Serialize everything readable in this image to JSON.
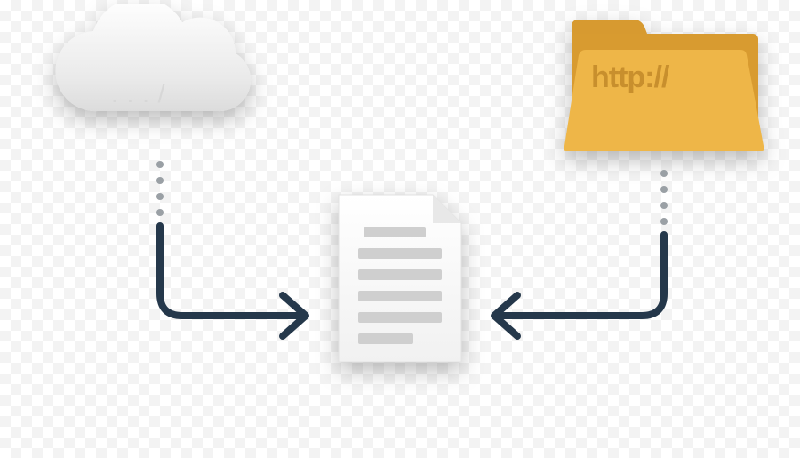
{
  "diagram": {
    "source_cloud": {
      "label": ". . . /"
    },
    "source_folder": {
      "label": "http://"
    },
    "target_document": {
      "line_count": 6
    },
    "colors": {
      "stroke": "#25384b",
      "dot": "#9aa0a5",
      "cloud_fill_light": "#f3f3f3",
      "cloud_fill_dark": "#e4e4e4",
      "folder_light": "#eeb648",
      "folder_dark": "#d89b30",
      "doc_fill": "#ffffff",
      "doc_line": "#cfcfcf"
    }
  }
}
